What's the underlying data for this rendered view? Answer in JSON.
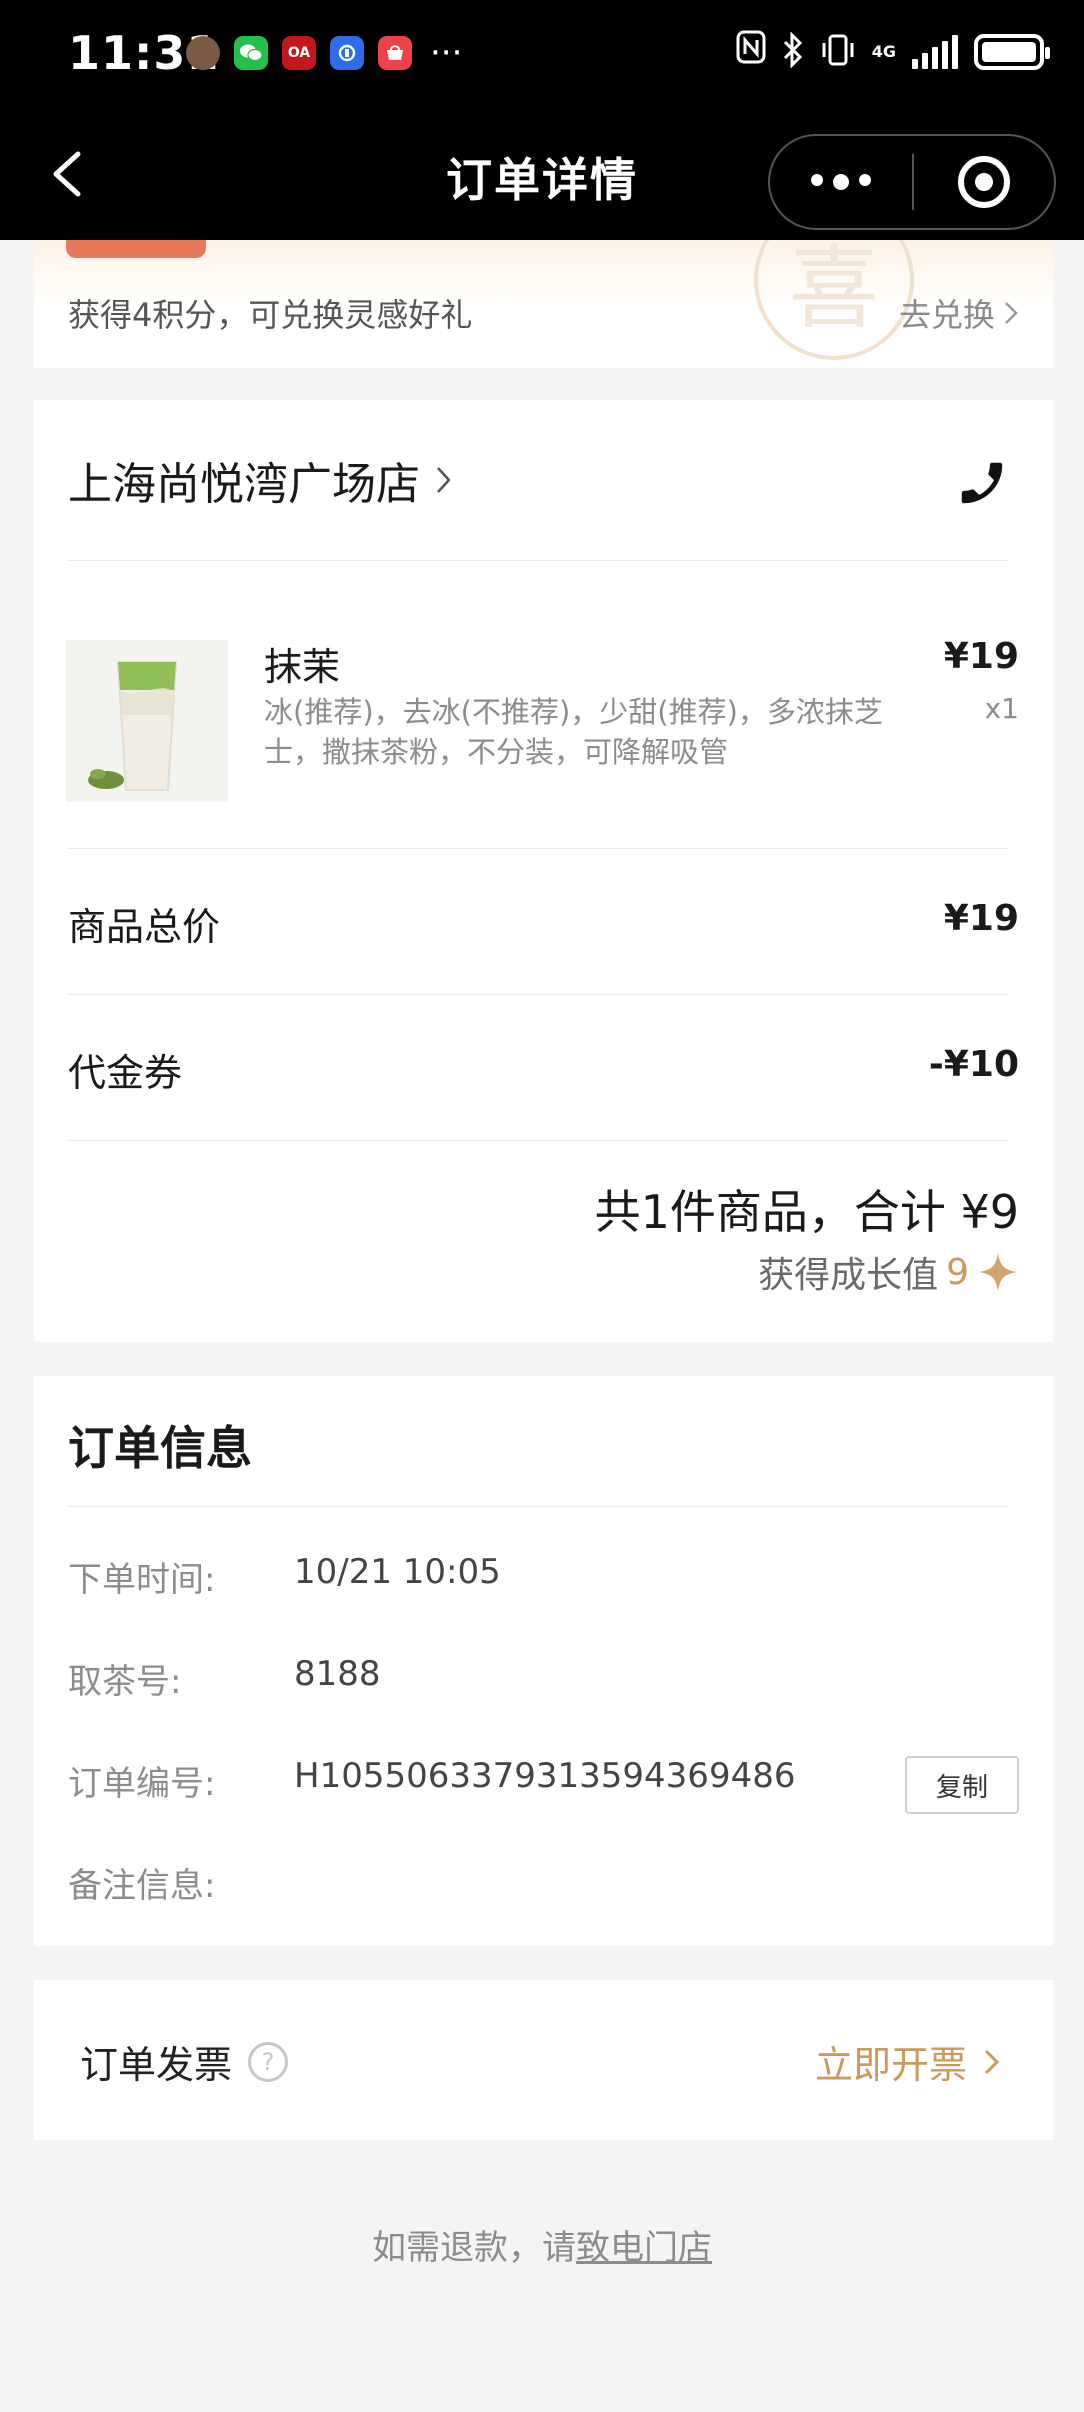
{
  "status_bar": {
    "time": "11:31",
    "network": "4G",
    "more": "···"
  },
  "nav": {
    "title": "订单详情"
  },
  "points_card": {
    "points_text": "获得4积分，可兑换灵感好礼",
    "redeem_link": "去兑换",
    "seal_char": "喜"
  },
  "order_card": {
    "store_name": "上海尚悦湾广场店",
    "item": {
      "name": "抹茉",
      "options": "冰(推荐)，去冰(不推荐)，少甜(推荐)，多浓抹芝士，撒抹茶粉，不分装，可降解吸管",
      "price": "¥19",
      "qty": "x1"
    },
    "subtotal_label": "商品总价",
    "subtotal_value": "¥19",
    "voucher_label": "代金券",
    "voucher_value": "-¥10",
    "total_text": "共1件商品，合计 ¥9",
    "growth_label": "获得成长值",
    "growth_value": "9"
  },
  "order_info": {
    "title": "订单信息",
    "rows": [
      {
        "label": "下单时间:",
        "value": "10/21 10:05"
      },
      {
        "label": "取茶号:",
        "value": "8188"
      },
      {
        "label": "订单编号:",
        "value": "H105506337931359436948​6"
      },
      {
        "label": "备注信息:",
        "value": ""
      }
    ],
    "copy_label": "复制"
  },
  "invoice": {
    "title": "订单发票",
    "help": "?",
    "action": "立即开票"
  },
  "refund": {
    "prefix": "如需退款，请",
    "link": "致电门店"
  },
  "colors": {
    "accent_gold": "#c99a5b",
    "bar_black": "#000000",
    "page_bg": "#f4f4f4"
  }
}
